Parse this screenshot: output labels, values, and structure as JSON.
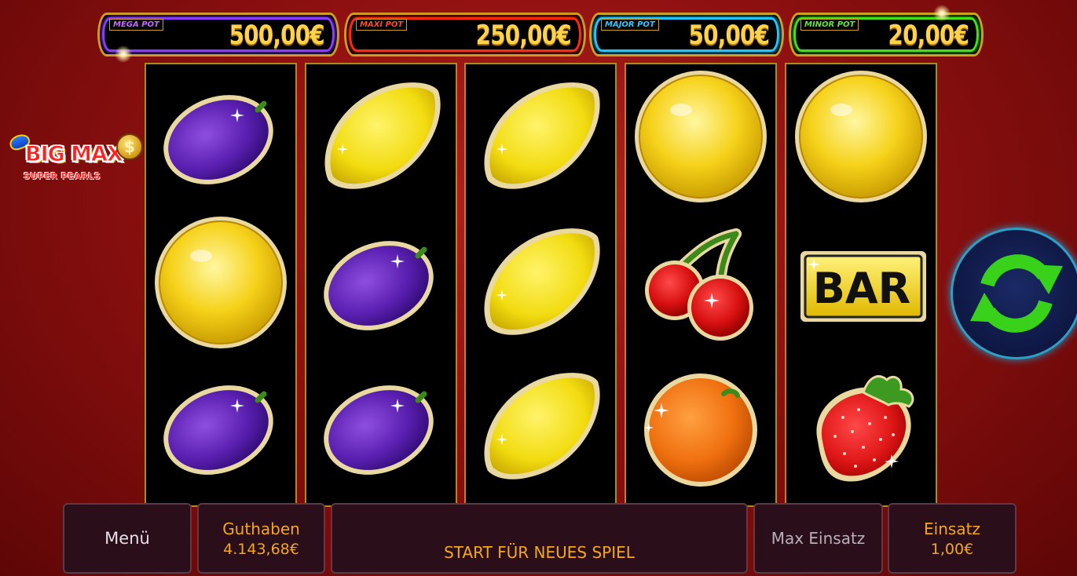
{
  "jackpots": [
    {
      "label": "MEGA POT",
      "value": "500,00€",
      "color": "#8a3cff"
    },
    {
      "label": "MAXI POT",
      "value": "250,00€",
      "color": "#ff2a10"
    },
    {
      "label": "MAJOR POT",
      "value": "50,00€",
      "color": "#22c6ff"
    },
    {
      "label": "MINOR POT",
      "value": "20,00€",
      "color": "#44e018"
    }
  ],
  "logo": {
    "title": "BIG MAX",
    "coin_symbol": "$",
    "subtitle": "SUPER PEARLS"
  },
  "reels": [
    [
      "plum",
      "golden-pearl",
      "plum"
    ],
    [
      "lemon",
      "plum",
      "plum"
    ],
    [
      "lemon",
      "lemon",
      "lemon"
    ],
    [
      "golden-pearl",
      "cherry",
      "orange"
    ],
    [
      "golden-pearl",
      "bar",
      "strawberry"
    ]
  ],
  "symbols": {
    "bar_text": "BAR"
  },
  "spin_button": {
    "icon": "refresh-icon",
    "color": "#39d21a"
  },
  "controls": {
    "menu_label": "Menü",
    "balance_label": "Guthaben",
    "balance_value": "4.143,68€",
    "start_label": "START FÜR NEUES SPIEL",
    "max_bet_label": "Max Einsatz",
    "bet_label": "Einsatz",
    "bet_value": "1,00€"
  },
  "colors": {
    "background": "#8e1010",
    "reel_border": "#b08a1a",
    "accent_text": "#f2a81a"
  }
}
